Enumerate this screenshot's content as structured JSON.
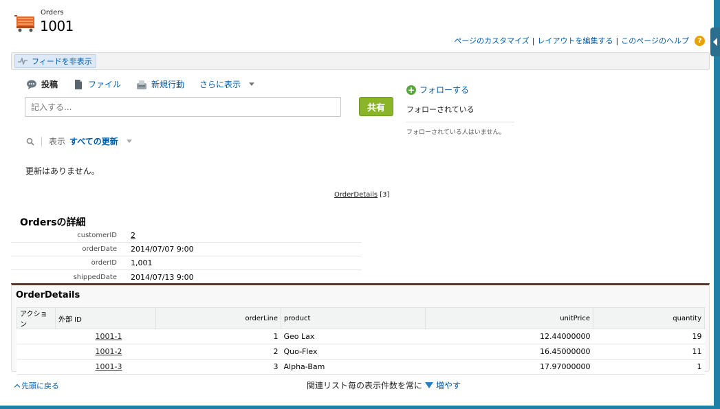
{
  "header": {
    "object_label": "Orders",
    "record_title": "1001",
    "links": {
      "customize": "ページのカスタマイズ",
      "edit_layout": "レイアウトを編集する",
      "help": "このページのヘルプ",
      "sep": "|",
      "help_icon": "?"
    }
  },
  "feed": {
    "toggle_label": "フィードを非表示",
    "tabs": {
      "post": "投稿",
      "file": "ファイル",
      "new_action": "新規行動",
      "more": "さらに表示"
    },
    "input_placeholder": "記入する...",
    "share_label": "共有",
    "filter": {
      "show_label": "表示",
      "value": "すべての更新"
    },
    "no_updates": "更新はありません。"
  },
  "follow": {
    "follow_label": "フォローする",
    "followed_by_label": "フォローされている",
    "no_followers": "フォローされている人はいません。"
  },
  "related_hover": {
    "label": "OrderDetails",
    "count": "[3]"
  },
  "detail": {
    "title": "Ordersの詳細",
    "rows": [
      {
        "label": "customerID",
        "value": "2"
      },
      {
        "label": "orderDate",
        "value": "2014/07/07 9:00"
      },
      {
        "label": "orderID",
        "value": "1,001"
      },
      {
        "label": "shippedDate",
        "value": "2014/07/13 9:00"
      }
    ]
  },
  "related_list": {
    "title": "OrderDetails",
    "columns": [
      "アクション",
      "外部 ID",
      "orderLine",
      "product",
      "unitPrice",
      "quantity"
    ],
    "rows": [
      {
        "ext_id": "1001-1",
        "order_line": "1",
        "product": "Geo Lax",
        "unit_price": "12.44000000",
        "quantity": "19"
      },
      {
        "ext_id": "1001-2",
        "order_line": "2",
        "product": "Quo-Flex",
        "unit_price": "16.45000000",
        "quantity": "11"
      },
      {
        "ext_id": "1001-3",
        "order_line": "3",
        "product": "Alpha-Bam",
        "unit_price": "17.97000000",
        "quantity": "1"
      }
    ]
  },
  "footer": {
    "back_to_top": "先頭に戻る",
    "show_more_prefix": "関連リスト毎の表示件数を常に",
    "show_more_link": "増やす"
  }
}
